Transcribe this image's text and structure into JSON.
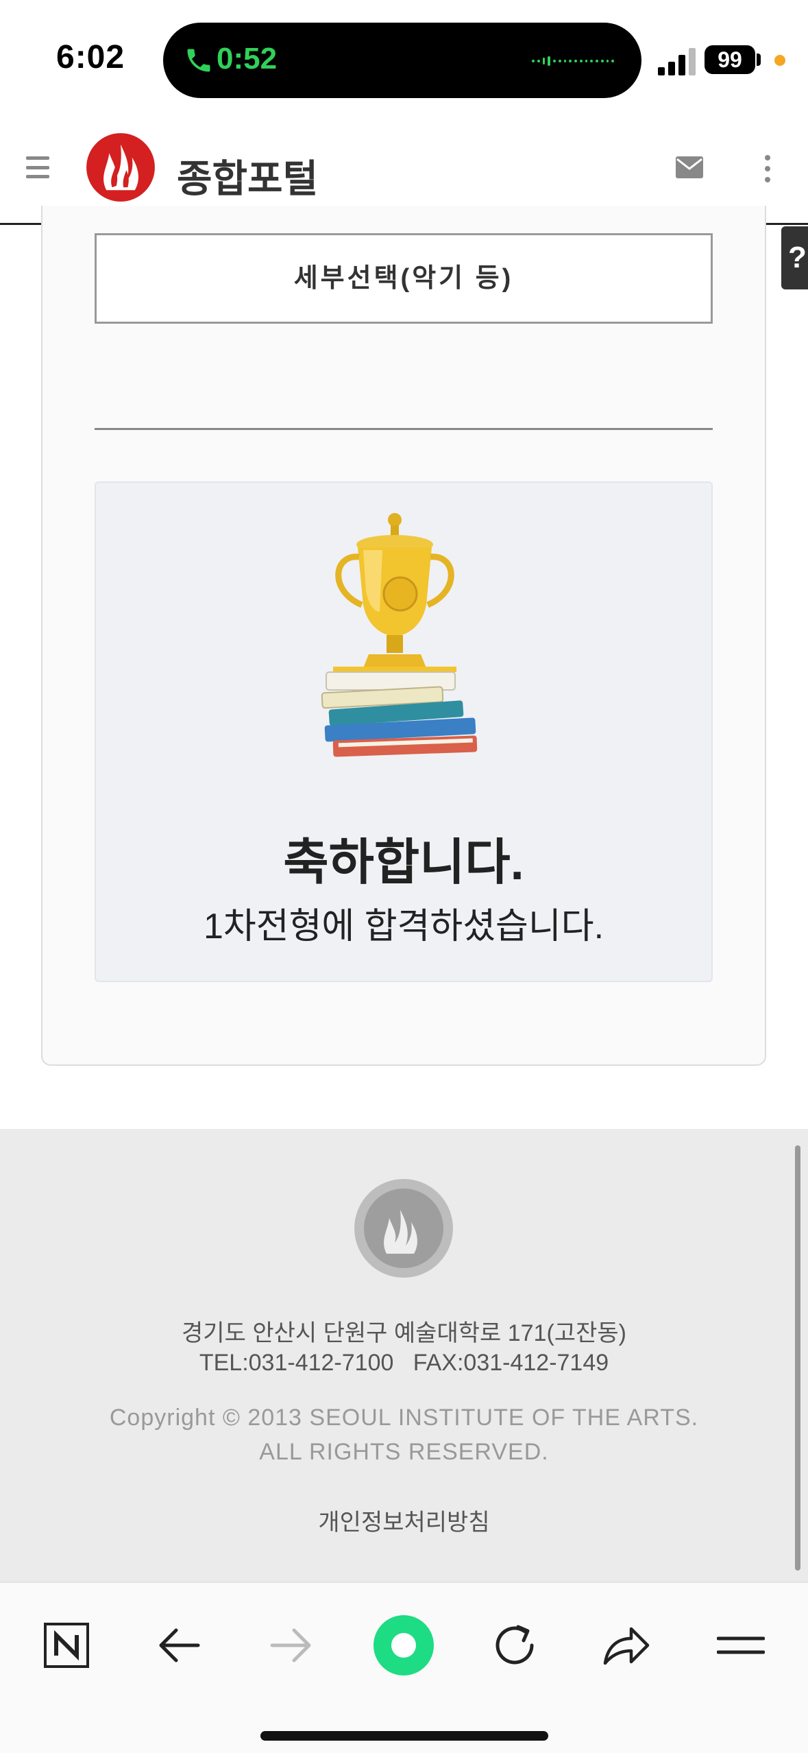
{
  "status_bar": {
    "time": "6:02",
    "call_timer": "0:52",
    "battery": "99"
  },
  "header": {
    "title": "종합포털"
  },
  "help_label": "?",
  "card": {
    "detail_button_label": "세부선택(악기 등)",
    "result": {
      "congrats": "축하합니다.",
      "message": "1차전형에 합격하셨습니다."
    }
  },
  "footer": {
    "address": "경기도 안산시 단원구 예술대학로 171(고잔동)",
    "contact": "TEL:031-412-7100   FAX:031-412-7149",
    "copyright_line1": "Copyright © 2013 SEOUL INSTITUTE OF THE ARTS.",
    "copyright_line2": "ALL RIGHTS RESERVED.",
    "privacy_link": "개인정보처리방침"
  },
  "browser_toolbar": {
    "icons": [
      "naver-icon",
      "back-icon",
      "forward-icon",
      "green-dot-icon",
      "reload-icon",
      "share-icon",
      "menu-icon"
    ]
  },
  "colors": {
    "call_green": "#30d158",
    "brand_red": "#d42020",
    "naver_green": "#03c75a"
  }
}
